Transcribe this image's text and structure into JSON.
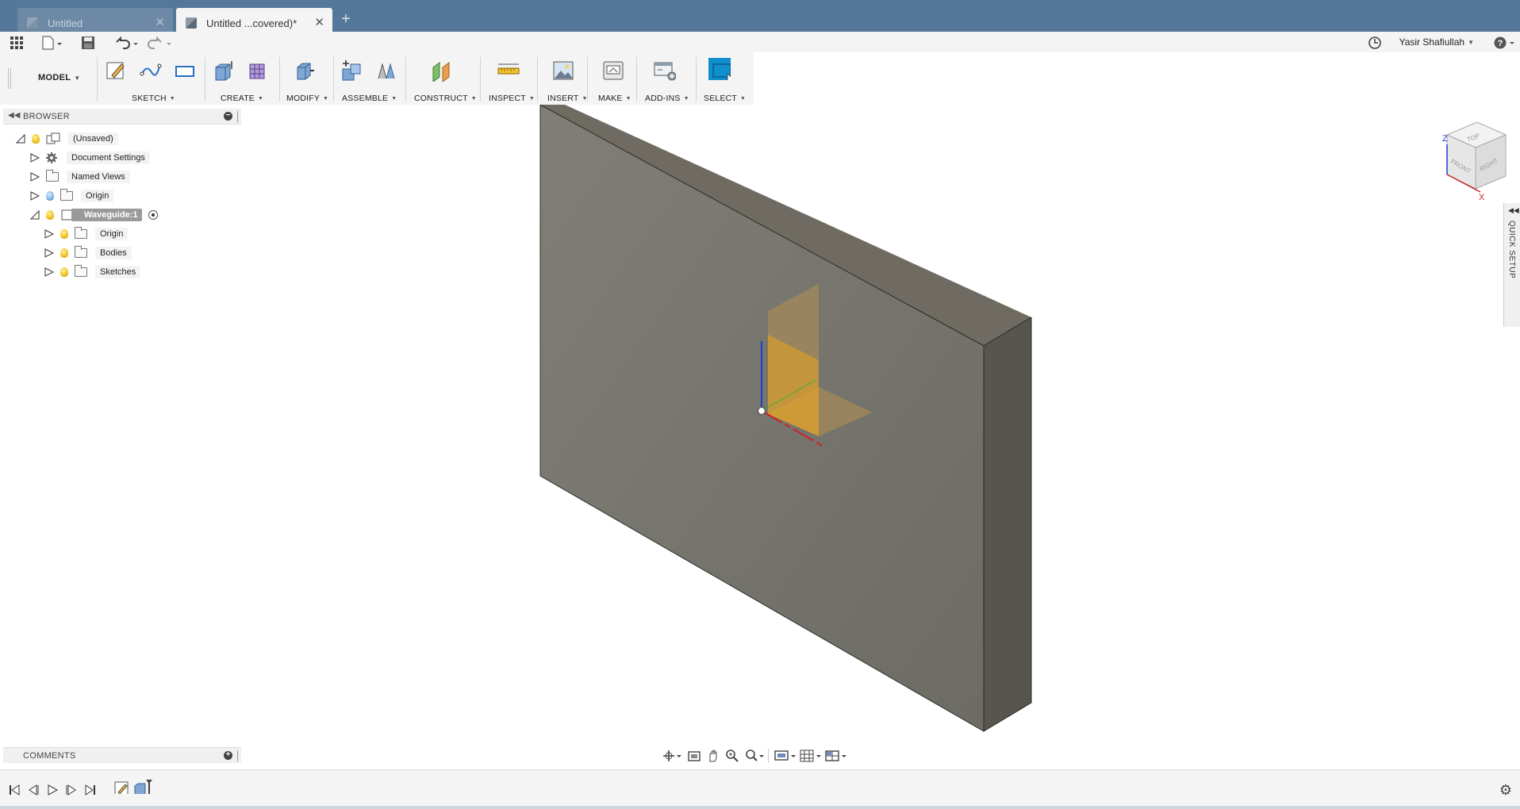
{
  "tabs": [
    {
      "label": "Untitled",
      "active": false
    },
    {
      "label": "Untitled ...covered)*",
      "active": true
    }
  ],
  "quick_access": {
    "user_name": "Yasir Shafiullah"
  },
  "toolbar": {
    "workspace": "MODEL",
    "groups": [
      {
        "label": "SKETCH"
      },
      {
        "label": "CREATE"
      },
      {
        "label": "MODIFY"
      },
      {
        "label": "ASSEMBLE"
      },
      {
        "label": "CONSTRUCT"
      },
      {
        "label": "INSPECT"
      },
      {
        "label": "INSERT"
      },
      {
        "label": "MAKE"
      },
      {
        "label": "ADD-INS"
      },
      {
        "label": "SELECT"
      }
    ],
    "accent": "#0f8fcd"
  },
  "browser": {
    "title": "BROWSER",
    "root": "(Unsaved)",
    "items": [
      {
        "label": "Document Settings"
      },
      {
        "label": "Named Views"
      },
      {
        "label": "Origin"
      },
      {
        "label": "Waveguide:1"
      },
      {
        "label": "Origin"
      },
      {
        "label": "Bodies"
      },
      {
        "label": "Sketches"
      }
    ]
  },
  "viewcube": {
    "faces": [
      "TOP",
      "FRONT",
      "RIGHT"
    ],
    "axes": [
      "Z",
      "X"
    ]
  },
  "quick_setup": {
    "label": "QUICK SETUP"
  },
  "comments": {
    "title": "COMMENTS"
  },
  "colors": {
    "tabbar": "#557799",
    "body_front": "#7a7a72",
    "body_side": "#5a574f",
    "body_top": "#6e6a61"
  }
}
